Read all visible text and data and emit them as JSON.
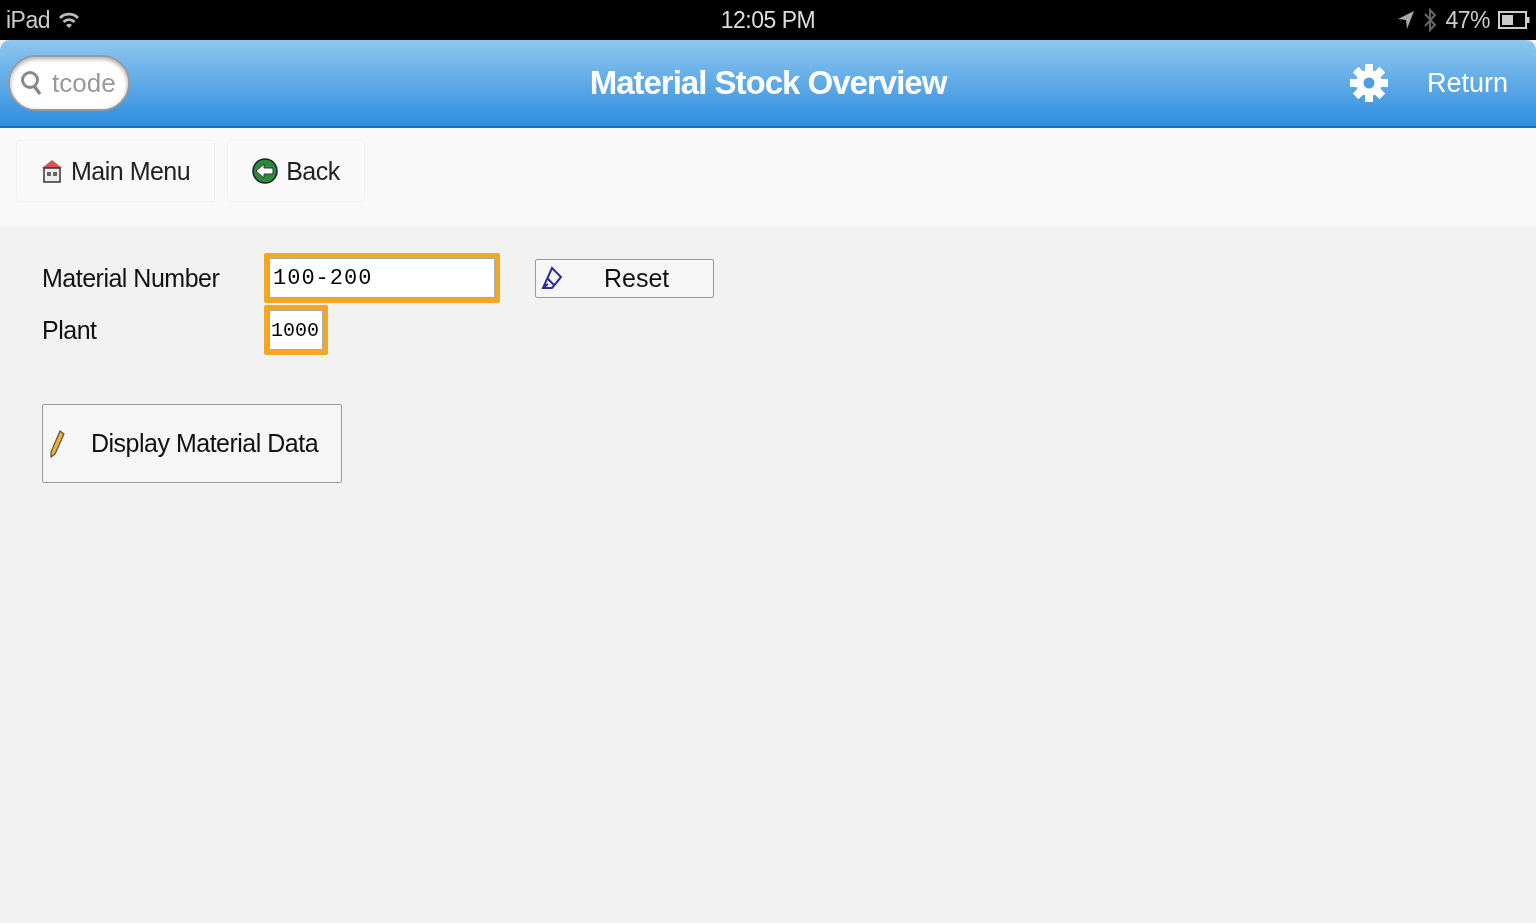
{
  "status_bar": {
    "device": "iPad",
    "time": "12:05 PM",
    "battery": "47%"
  },
  "nav_bar": {
    "search": {
      "placeholder": "tcode"
    },
    "title": "Material Stock Overview",
    "return": "Return"
  },
  "toolbar": [
    {
      "kind": "home",
      "label": "Main Menu"
    },
    {
      "kind": "back",
      "label": "Back"
    }
  ],
  "form": {
    "fields": [
      {
        "label": "Material Number",
        "value": "100-200",
        "highlighted": true
      },
      {
        "label": "Plant",
        "value": "1000",
        "highlighted": true
      }
    ],
    "reset": "Reset",
    "display_button": "Display Material Data"
  }
}
